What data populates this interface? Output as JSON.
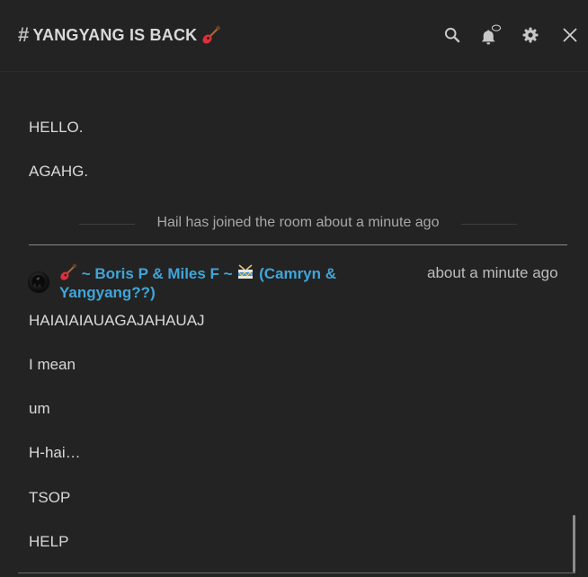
{
  "header": {
    "hash": "#",
    "room_name": "YANGYANG IS BACK",
    "room_emoji": "guitar-emoji",
    "icons": [
      "search-icon",
      "bell-icon",
      "settings-icon",
      "close-icon"
    ]
  },
  "timeline": {
    "prior_messages": [
      "HELLO.",
      "AGAHG."
    ],
    "event": "Hail has joined the room about a minute ago",
    "sender": {
      "prefix_emoji": "guitar-emoji",
      "name_part1": "~ Boris P & Miles F ~",
      "mid_emoji": "drum-emoji",
      "name_part2": "(Camryn &",
      "name_part3": "Yangyang??)",
      "color": "#3fa6da"
    },
    "timestamp": "about a minute ago",
    "messages": [
      "HAIAIAIAUAGAJAHAUAJ",
      "I mean",
      "um",
      "H-hai…",
      "TSOP",
      "HELP"
    ]
  },
  "colors": {
    "background": "#232323",
    "text": "#d9d9d9",
    "muted": "#a8a8a8",
    "accent": "#3fa6da"
  }
}
